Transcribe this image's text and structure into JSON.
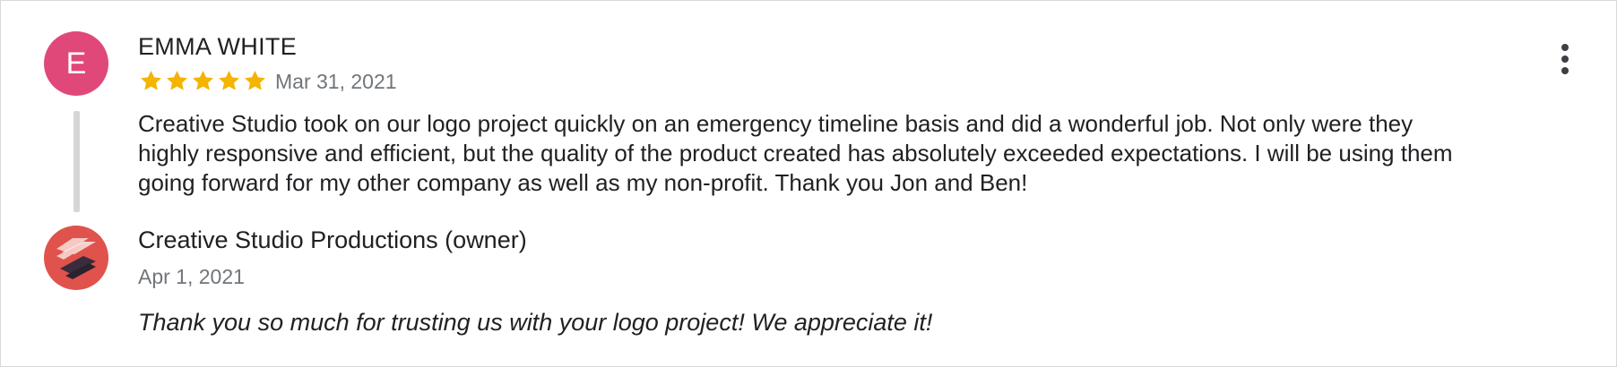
{
  "review": {
    "avatar_letter": "E",
    "avatar_color": "#e0487a",
    "reviewer_name": "EMMA WHITE",
    "rating": 5,
    "rating_max": 5,
    "star_color": "#f4b400",
    "date": "Mar 31, 2021",
    "text": "Creative Studio took on our logo project quickly on an emergency timeline basis and did a wonderful job. Not only were they highly responsive and efficient, but the quality of the product created has absolutely exceeded expectations. I will be using them going forward for my other company as well as my non-profit. Thank you Jon and Ben!",
    "menu_icon": "more-vert-icon"
  },
  "owner_response": {
    "logo_icon": "creative-studio-logo-icon",
    "logo_color": "#e0524c",
    "name": "Creative Studio Productions (owner)",
    "date": "Apr 1, 2021",
    "reply": "Thank you so much for trusting us with your logo project! We appreciate it!"
  }
}
